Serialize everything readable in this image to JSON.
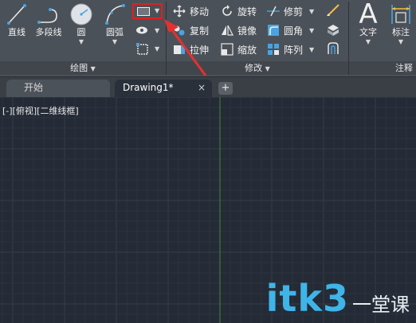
{
  "ribbon": {
    "draw_group": {
      "title": "绘图",
      "line": "直线",
      "polyline": "多段线",
      "circle": "圆",
      "arc": "圆弧"
    },
    "modify_group": {
      "title": "修改",
      "move": "移动",
      "rotate": "旋转",
      "trim": "修剪",
      "copy": "复制",
      "mirror": "镜像",
      "fillet": "圆角",
      "stretch": "拉伸",
      "scale": "缩放",
      "array": "阵列"
    },
    "annotate_group": {
      "title": "注释",
      "text": "文字",
      "dimension": "标注"
    },
    "colors": {
      "highlight_box": "#e02020",
      "arrow": "#e53030"
    }
  },
  "tabs": [
    {
      "label": "开始",
      "active": false
    },
    {
      "label": "Drawing1*",
      "active": true
    }
  ],
  "tab_add_label": "+",
  "tab_close_label": "×",
  "viewport": {
    "label": "[-][俯视][二维线框]"
  },
  "watermark": {
    "latin": "itk3",
    "chinese": "一堂课"
  },
  "colors": {
    "canvas_bg": "#252b36",
    "grid_minor": "#2c3340",
    "grid_major": "#343c4a",
    "y_axis": "#3c8a3c"
  }
}
